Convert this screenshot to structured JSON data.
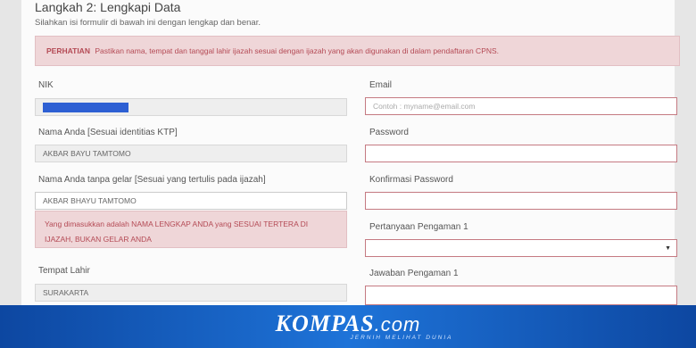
{
  "header": {
    "title": "Langkah 2: Lengkapi Data",
    "subtitle": "Silahkan isi formulir di bawah ini dengan lengkap dan benar."
  },
  "notice": {
    "label": "PERHATIAN",
    "text": "Pastikan nama, tempat dan tanggal lahir ijazah sesuai dengan ijazah yang akan digunakan di dalam pendaftaran CPNS."
  },
  "left": {
    "nik_label": "NIK",
    "name_ktp_label": "Nama Anda [Sesuai identitias KTP]",
    "name_ktp_value": "AKBAR BAYU TAMTOMO",
    "name_ijazah_label": "Nama Anda tanpa gelar [Sesuai yang tertulis pada ijazah]",
    "name_ijazah_value": "AKBAR BHAYU TAMTOMO",
    "warning_text": "Yang dimasukkan adalah NAMA LENGKAP ANDA yang SESUAI TERTERA DI IJAZAH, BUKAN GELAR ANDA",
    "birthplace_label": "Tempat Lahir",
    "birthplace_value": "SURAKARTA"
  },
  "right": {
    "email_label": "Email",
    "email_placeholder": "Contoh : myname@email.com",
    "password_label": "Password",
    "confirm_label": "Konfirmasi Password",
    "question_label": "Pertanyaan Pengaman 1",
    "answer_label": "Jawaban Pengaman 1"
  },
  "branding": {
    "logo_main": "KOMPAS",
    "logo_suffix": ".com",
    "tagline": "JERNIH MELIHAT DUNIA"
  },
  "colors": {
    "alert_bg": "#efd6d8",
    "alert_text": "#b44a55",
    "banner": "#1565c0",
    "redacted": "#2d5fd3"
  }
}
